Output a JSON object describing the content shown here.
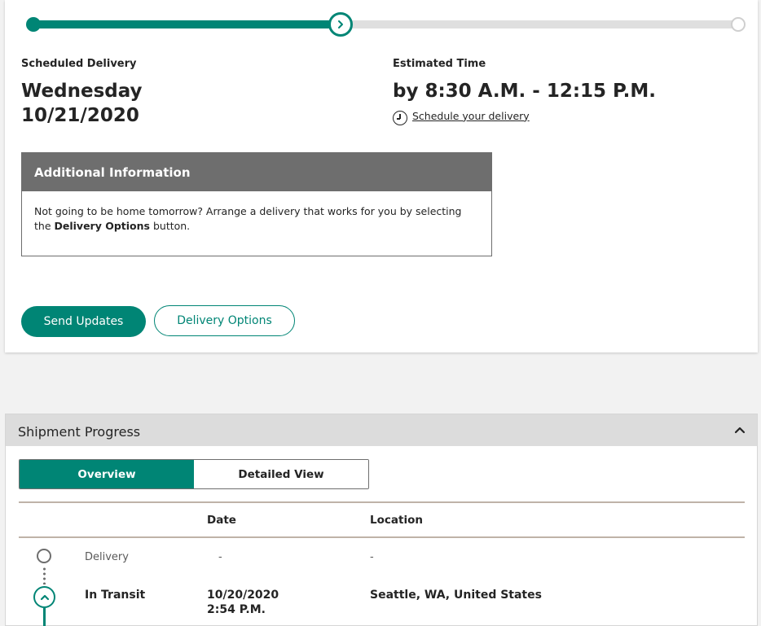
{
  "colors": {
    "accent": "#008575",
    "header_gray": "#6e6e6e",
    "panel_header": "#dcdcdc"
  },
  "delivery": {
    "progress_fraction": 0.43,
    "current_marker_icon": "chevron-right-icon",
    "scheduled_label": "Scheduled Delivery",
    "scheduled_day": "Wednesday",
    "scheduled_date": "10/21/2020",
    "estimated_label": "Estimated Time",
    "estimated_time": "by 8:30 A.M. - 12:15 P.M.",
    "schedule_link": "Schedule your delivery"
  },
  "additional_info": {
    "title": "Additional Information",
    "body_prefix": "Not going to be home tomorrow? Arrange a delivery that works for you by selecting the ",
    "body_bold": "Delivery Options",
    "body_suffix": " button."
  },
  "buttons": {
    "send_updates": "Send Updates",
    "delivery_options": "Delivery Options"
  },
  "shipment": {
    "title": "Shipment Progress",
    "collapse_icon": "chevron-up-icon",
    "tabs": [
      "Overview",
      "Detailed View"
    ],
    "active_tab": "Overview",
    "columns": {
      "date": "Date",
      "location": "Location"
    },
    "rows": [
      {
        "status": "Delivery",
        "date": "-",
        "time": "",
        "location": "-"
      },
      {
        "status": "In Transit",
        "date": "10/20/2020",
        "time": "2:54 P.M.",
        "location": "Seattle, WA, United States"
      }
    ]
  }
}
